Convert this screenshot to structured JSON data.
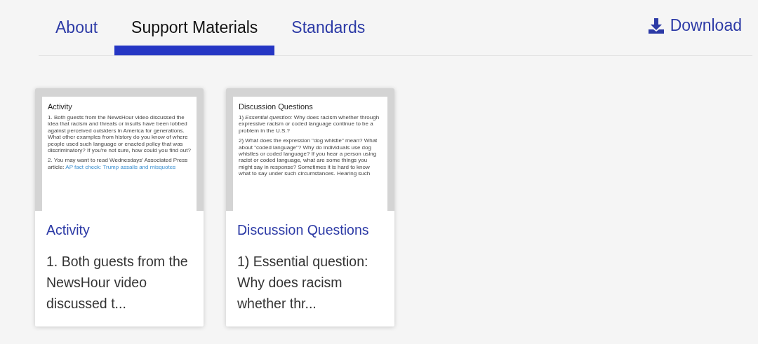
{
  "tabs": [
    {
      "label": "About",
      "selected": false
    },
    {
      "label": "Support Materials",
      "selected": true
    },
    {
      "label": "Standards",
      "selected": false
    }
  ],
  "download": {
    "label": "Download"
  },
  "cards": [
    {
      "preview": {
        "title": "Activity",
        "paragraphs": [
          {
            "text": "1. Both guests from the NewsHour video discussed the idea that racism and threats or insults have been lobbed against perceived outsiders in America for generations. What other examples from history do you know of where people used such language or enacted policy that was discriminatory? If you're not sure, how could you find out?"
          },
          {
            "text": "2. You may want to read Wednesdays' Associated Press article:",
            "link": "AP fact check: Trump assails and misquotes"
          }
        ]
      },
      "title": "Activity",
      "excerpt": "1. Both guests from the NewsHour video discussed t..."
    },
    {
      "preview": {
        "title": "Discussion Questions",
        "paragraphs": [
          {
            "text": "1) *Essential question:* Why does racism whether through expressive racism or coded language continue to be a problem in the U.S.?"
          },
          {
            "text": "2) What does the expression \"dog whistle\" mean? What about \"coded language\"? Why do individuals use dog whistles or coded language? If you hear a person using racist or coded language, what are some things you might say in response? Sometimes it is hard to know what to say under such circumstances. Hearing such"
          }
        ]
      },
      "title": "Discussion Questions",
      "excerpt": "1) Essential question: Why does racism whether thr..."
    }
  ]
}
